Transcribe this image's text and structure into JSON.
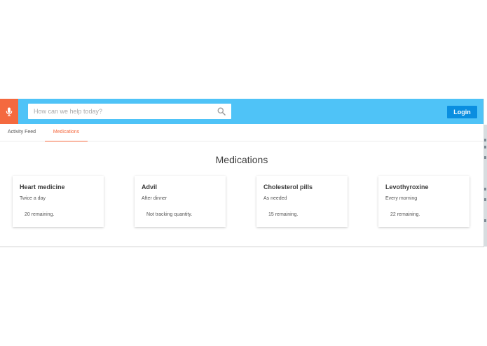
{
  "header": {
    "search": {
      "placeholder": "How can we help today?",
      "value": ""
    },
    "login_label": "Login",
    "mic_icon": "microphone-icon",
    "search_icon": "magnifier-icon"
  },
  "tabs": [
    {
      "label": "Activity Feed",
      "active": false
    },
    {
      "label": "Medications",
      "active": true
    }
  ],
  "page_title": "Medications",
  "medications": [
    {
      "name": "Heart medicine",
      "frequency": "Twice a day",
      "remaining": "20 remaining."
    },
    {
      "name": "Advil",
      "frequency": "After dinner",
      "remaining": "Not tracking quantity."
    },
    {
      "name": "Cholesterol pills",
      "frequency": "As needed",
      "remaining": "15 remaining."
    },
    {
      "name": "Levothyroxine",
      "frequency": "Every morning",
      "remaining": "22 remaining."
    }
  ],
  "colors": {
    "header_bg": "#4fc3f7",
    "mic_bg": "#f4693f",
    "login_bg": "#0a8ee0",
    "tab_active": "#f4693f"
  }
}
